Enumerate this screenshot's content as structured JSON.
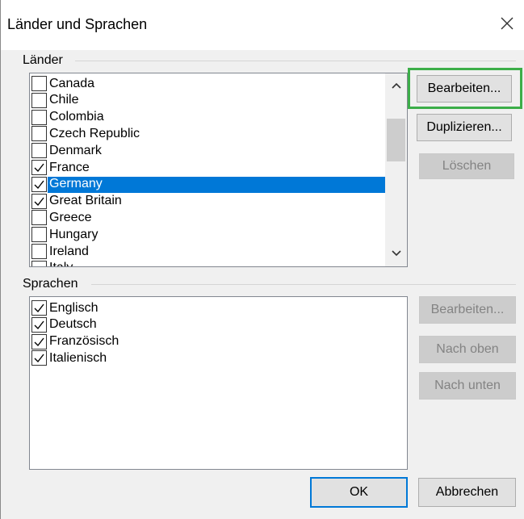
{
  "window": {
    "title": "Länder und Sprachen",
    "close_symbol": "✕"
  },
  "countries": {
    "group_label": "Länder",
    "items": [
      {
        "label": "Canada",
        "checked": false
      },
      {
        "label": "Chile",
        "checked": false
      },
      {
        "label": "Colombia",
        "checked": false
      },
      {
        "label": "Czech Republic",
        "checked": false
      },
      {
        "label": "Denmark",
        "checked": false
      },
      {
        "label": "France",
        "checked": true
      },
      {
        "label": "Germany",
        "checked": true,
        "selected": true
      },
      {
        "label": "Great Britain",
        "checked": true
      },
      {
        "label": "Greece",
        "checked": false
      },
      {
        "label": "Hungary",
        "checked": false
      },
      {
        "label": "Ireland",
        "checked": false
      },
      {
        "label": "Italy",
        "checked": false
      }
    ],
    "buttons": {
      "edit": "Bearbeiten...",
      "duplicate": "Duplizieren...",
      "delete": "Löschen"
    }
  },
  "languages": {
    "group_label": "Sprachen",
    "items": [
      {
        "label": "Englisch",
        "checked": true
      },
      {
        "label": "Deutsch",
        "checked": true
      },
      {
        "label": "Französisch",
        "checked": true
      },
      {
        "label": "Italienisch",
        "checked": true
      }
    ],
    "buttons": {
      "edit": "Bearbeiten...",
      "move_up": "Nach oben",
      "move_down": "Nach unten"
    }
  },
  "footer": {
    "ok": "OK",
    "cancel": "Abbrechen"
  },
  "colors": {
    "selection": "#0078d7",
    "highlight_frame": "#3cae49"
  }
}
